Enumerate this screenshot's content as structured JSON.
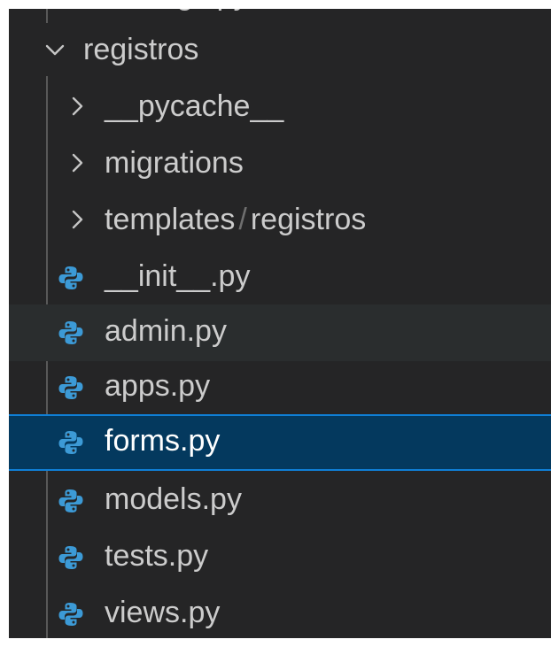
{
  "partial_top_item": "settings.py",
  "folder": {
    "name": "registros",
    "expanded": true
  },
  "subfolders": [
    {
      "name": "__pycache__"
    },
    {
      "name": "migrations"
    },
    {
      "name": "templates",
      "compact_child": "registros"
    }
  ],
  "files": [
    {
      "name": "__init__.py",
      "icon": "python-file-icon"
    },
    {
      "name": "admin.py",
      "icon": "python-file-icon",
      "state": "hover"
    },
    {
      "name": "apps.py",
      "icon": "python-file-icon"
    },
    {
      "name": "forms.py",
      "icon": "python-file-icon",
      "state": "selected"
    },
    {
      "name": "models.py",
      "icon": "python-file-icon"
    },
    {
      "name": "tests.py",
      "icon": "python-file-icon"
    },
    {
      "name": "views.py",
      "icon": "python-file-icon"
    }
  ],
  "colors": {
    "background": "#252526",
    "hover": "#2a2d2e",
    "selected": "#04395e",
    "focus_border": "#0f7fd6",
    "python_blue": "#3c9ad6",
    "text": "#cccccc"
  }
}
